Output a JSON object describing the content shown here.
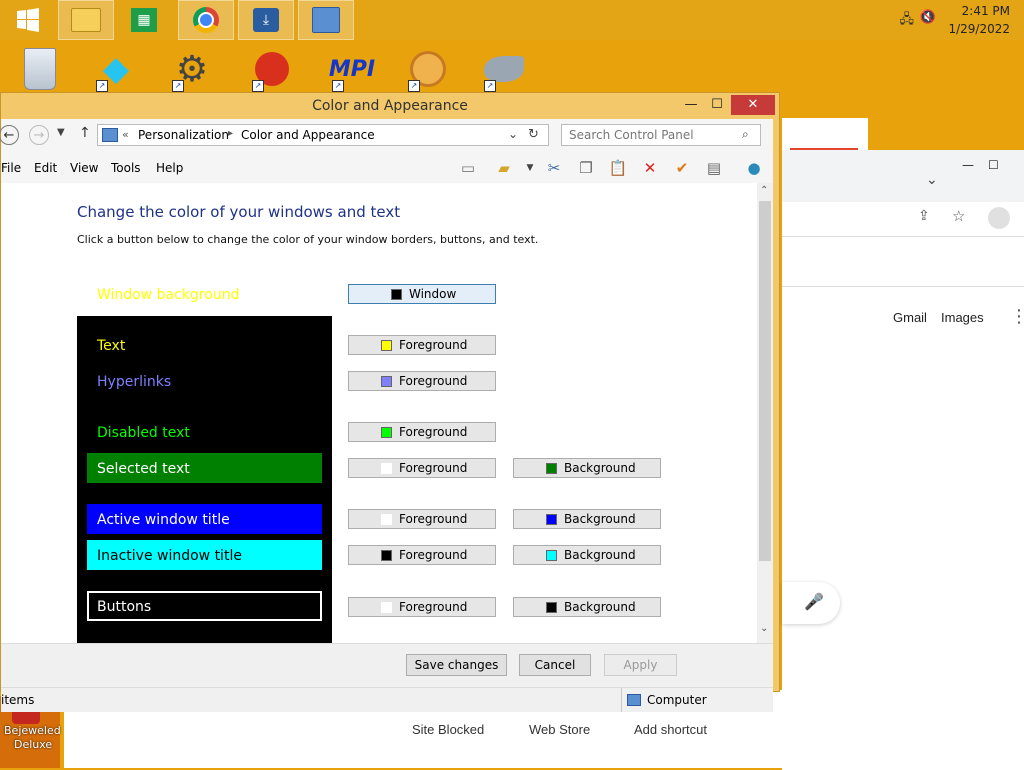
{
  "taskbar": {
    "time": "2:41 PM",
    "date": "1/29/2022",
    "apps": [
      "start-button",
      "file-explorer",
      "store",
      "chrome",
      "network-app",
      "control-panel"
    ]
  },
  "desktop": {
    "bottom_icon_label_1": "Bejeweled",
    "bottom_icon_label_2": "Deluxe"
  },
  "chrome_bg": {
    "gmail": "Gmail",
    "images": "Images",
    "site_blocked": "Site Blocked",
    "web_store": "Web Store",
    "add_shortcut": "Add shortcut"
  },
  "window": {
    "title": "Color and Appearance",
    "breadcrumb": [
      "Personalization",
      "Color and Appearance"
    ],
    "search_placeholder": "Search Control Panel",
    "menu": [
      "File",
      "Edit",
      "View",
      "Tools",
      "Help"
    ],
    "heading": "Change the color of your windows and text",
    "subheading": "Click a button below to change the color of your window borders, buttons, and text."
  },
  "preview": {
    "window_background": "Window background",
    "text": "Text",
    "hyperlinks": "Hyperlinks",
    "disabled_text": "Disabled text",
    "selected_text": "Selected text",
    "active_title": "Active window title",
    "inactive_title": "Inactive window title",
    "buttons": "Buttons"
  },
  "color_buttons": {
    "window": "Window",
    "foreground": "Foreground",
    "background": "Background"
  },
  "colors": {
    "text": "#ffff00",
    "hyperlink": "#8080ff",
    "disabled": "#00ff00",
    "selected_bg": "#008000",
    "active_bg": "#0000ff",
    "inactive_bg": "#00ffff"
  },
  "dialog": {
    "save": "Save changes",
    "cancel": "Cancel",
    "apply": "Apply"
  },
  "status": {
    "left": "items",
    "right": "Computer"
  }
}
